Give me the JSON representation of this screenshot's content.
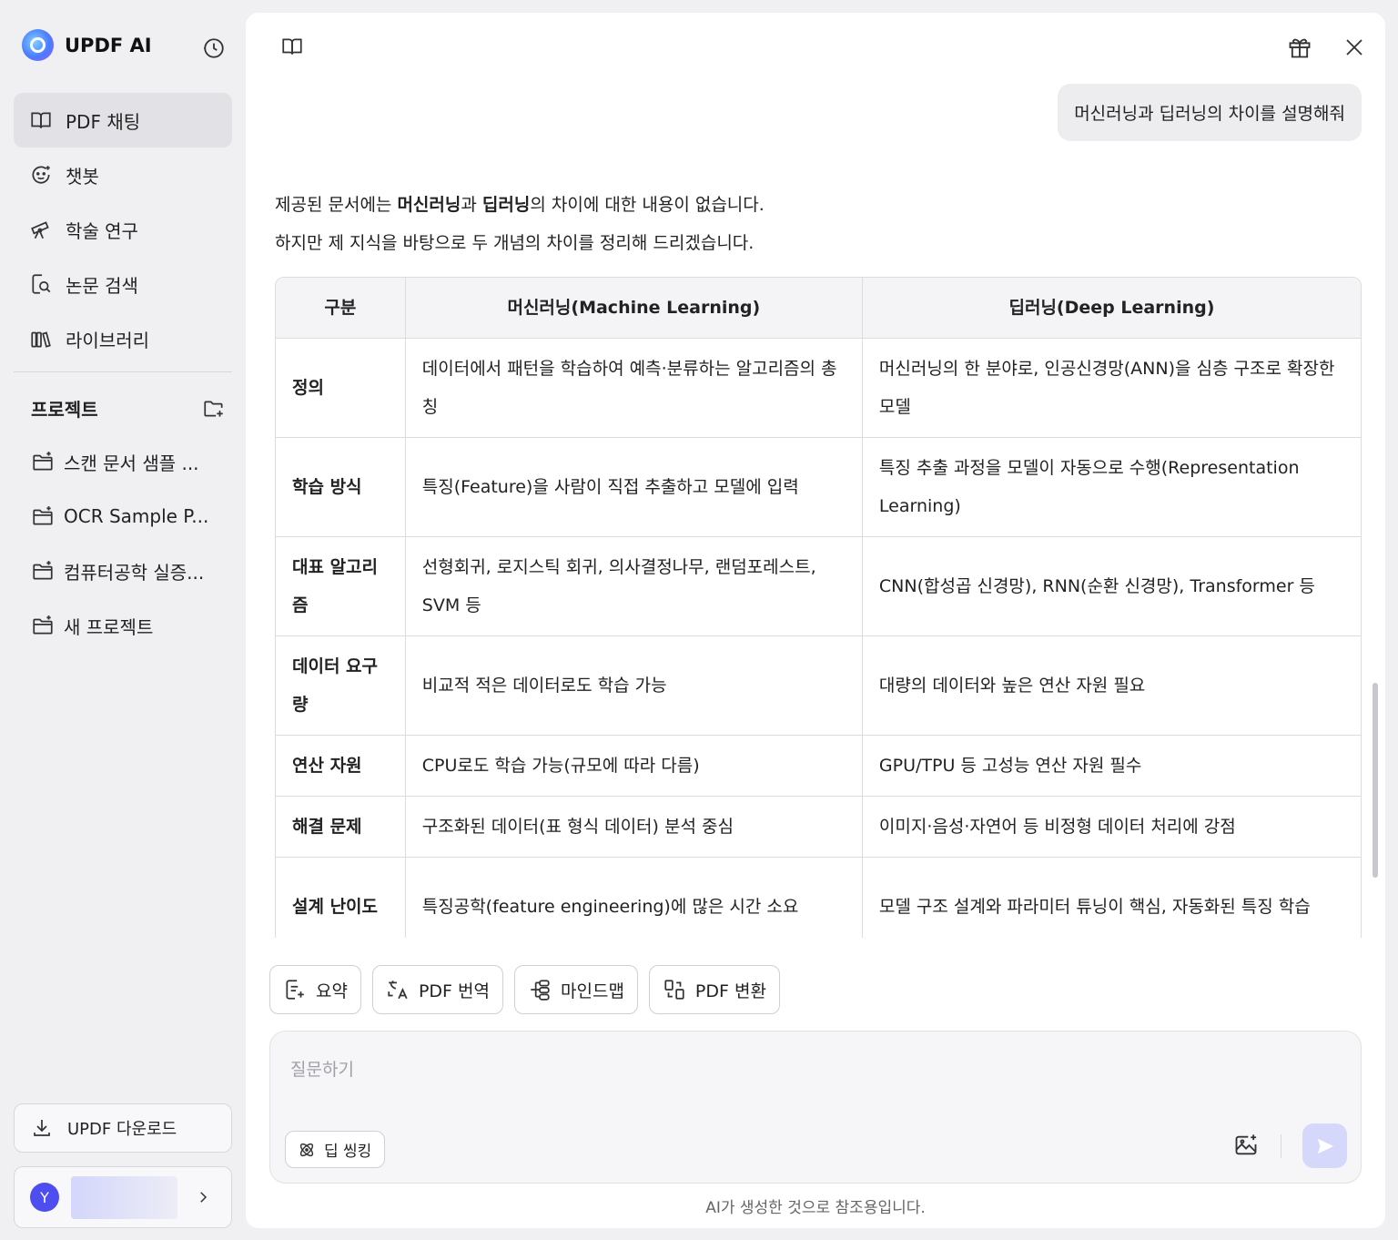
{
  "app": {
    "name": "UPDF AI"
  },
  "sidebar": {
    "nav": [
      {
        "label": "PDF 채팅",
        "icon": "book-open-icon",
        "active": true
      },
      {
        "label": "챗봇",
        "icon": "chatbot-icon",
        "active": false
      },
      {
        "label": "학술 연구",
        "icon": "telescope-icon",
        "active": false
      },
      {
        "label": "논문 검색",
        "icon": "doc-search-icon",
        "active": false
      },
      {
        "label": "라이브러리",
        "icon": "library-icon",
        "active": false
      }
    ],
    "projects_title": "프로젝트",
    "projects": [
      {
        "label": "스캔 문서 샘플 ..."
      },
      {
        "label": "OCR Sample P..."
      },
      {
        "label": "컴퓨터공학 실증..."
      },
      {
        "label": "새 프로젝트"
      }
    ],
    "download_label": "UPDF 다운로드",
    "user": {
      "initial": "Y"
    }
  },
  "chat": {
    "user_message": "머신러닝과 딥러닝의 차이를 설명해줘",
    "answer_line1": {
      "p1": "제공된 문서에는 ",
      "b1": "머신러닝",
      "p2": "과 ",
      "b2": "딥러닝",
      "p3": "의 차이에 대한 내용이 없습니다."
    },
    "answer_line2": "하지만 제 지식을 바탕으로 두 개념의 차이를 정리해 드리겠습니다.",
    "table": {
      "headers": [
        "구분",
        "머신러닝(Machine Learning)",
        "딥러닝(Deep Learning)"
      ],
      "rows": [
        [
          "정의",
          "데이터에서 패턴을 학습하여 예측·분류하는 알고리즘의 총칭",
          "머신러닝의 한 분야로, 인공신경망(ANN)을 심층 구조로 확장한 모델"
        ],
        [
          "학습 방식",
          "특징(Feature)을 사람이 직접 추출하고 모델에 입력",
          "특징 추출 과정을 모델이 자동으로 수행(Representation Learning)"
        ],
        [
          "대표 알고리즘",
          "선형회귀, 로지스틱 회귀, 의사결정나무, 랜덤포레스트, SVM 등",
          "CNN(합성곱 신경망), RNN(순환 신경망), Transformer 등"
        ],
        [
          "데이터 요구량",
          "비교적 적은 데이터로도 학습 가능",
          "대량의 데이터와 높은 연산 자원 필요"
        ],
        [
          "연산 자원",
          "CPU로도 학습 가능(규모에 따라 다름)",
          "GPU/TPU 등 고성능 연산 자원 필수"
        ],
        [
          "해결 문제",
          "구조화된 데이터(표 형식 데이터) 분석 중심",
          "이미지·음성·자연어 등 비정형 데이터 처리에 강점"
        ],
        [
          "설계 난이도",
          "특징공학(feature engineering)에 많은 시간 소요",
          "모델 구조 설계와 파라미터 튜닝이 핵심, 자동화된 특징 학습"
        ]
      ]
    }
  },
  "quick_actions": [
    {
      "label": "요약",
      "icon": "summary-icon"
    },
    {
      "label": "PDF 번역",
      "icon": "translate-icon"
    },
    {
      "label": "마인드맵",
      "icon": "mindmap-icon"
    },
    {
      "label": "PDF 변환",
      "icon": "convert-icon"
    }
  ],
  "composer": {
    "placeholder": "질문하기",
    "deep_thinking_label": "딥 씽킹"
  },
  "disclaimer": "AI가 생성한 것으로 참조용입니다.",
  "colors": {
    "accent": "#4d4df0",
    "send_disabled": "#d6d8fb",
    "sidebar_bg": "#f0f0f2",
    "active_nav": "#e2e2e6"
  }
}
